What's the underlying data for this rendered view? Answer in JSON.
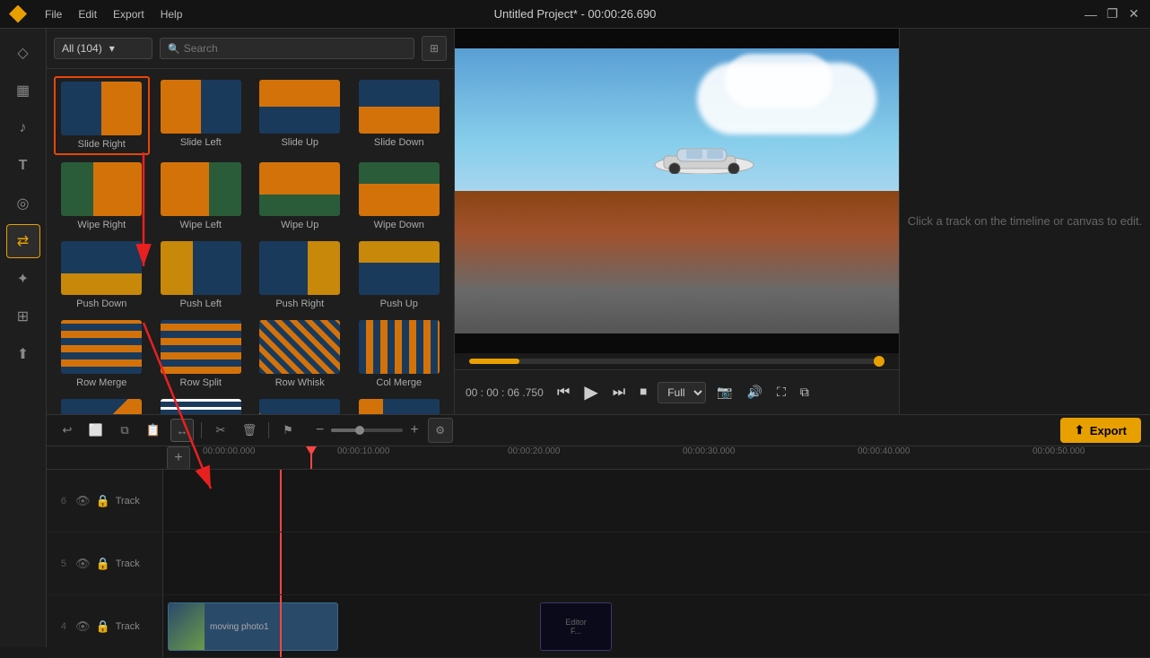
{
  "titlebar": {
    "title": "Untitled Project* - 00:00:26.690",
    "menu": [
      "File",
      "Edit",
      "Export",
      "Help"
    ],
    "controls": [
      "—",
      "❐",
      "✕"
    ]
  },
  "sidebar": {
    "items": [
      {
        "id": "logo",
        "icon": "◇",
        "label": "logo"
      },
      {
        "id": "media",
        "icon": "▦",
        "label": "media"
      },
      {
        "id": "audio",
        "icon": "🎵",
        "label": "audio"
      },
      {
        "id": "text",
        "icon": "T",
        "label": "text"
      },
      {
        "id": "effects",
        "icon": "◎",
        "label": "effects"
      },
      {
        "id": "transitions",
        "icon": "⇄",
        "label": "transitions",
        "active": true
      },
      {
        "id": "elements",
        "icon": "✦",
        "label": "elements"
      },
      {
        "id": "templates",
        "icon": "⊞",
        "label": "templates"
      },
      {
        "id": "export",
        "icon": "⬆",
        "label": "export"
      }
    ]
  },
  "panel": {
    "dropdown": {
      "label": "All (104)",
      "value": "All (104)"
    },
    "search": {
      "placeholder": "Search"
    },
    "transitions": [
      {
        "id": "slide-right",
        "label": "Slide Right",
        "thumb": "slide-right",
        "selected": true
      },
      {
        "id": "slide-left",
        "label": "Slide Left",
        "thumb": "slide-left"
      },
      {
        "id": "slide-up",
        "label": "Slide Up",
        "thumb": "slide-up"
      },
      {
        "id": "slide-down",
        "label": "Slide Down",
        "thumb": "slide-down"
      },
      {
        "id": "wipe-right",
        "label": "Wipe Right",
        "thumb": "wipe-right"
      },
      {
        "id": "wipe-left",
        "label": "Wipe Left",
        "thumb": "wipe-left"
      },
      {
        "id": "wipe-up",
        "label": "Wipe Up",
        "thumb": "wipe-up"
      },
      {
        "id": "wipe-down",
        "label": "Wipe Down",
        "thumb": "wipe-down"
      },
      {
        "id": "push-down",
        "label": "Push Down",
        "thumb": "push-down"
      },
      {
        "id": "push-left",
        "label": "Push Left",
        "thumb": "push-left"
      },
      {
        "id": "push-right",
        "label": "Push Right",
        "thumb": "push-right"
      },
      {
        "id": "push-up",
        "label": "Push Up",
        "thumb": "push-up"
      },
      {
        "id": "row-merge",
        "label": "Row Merge",
        "thumb": "row-merge"
      },
      {
        "id": "row-split",
        "label": "Row Split",
        "thumb": "row-split"
      },
      {
        "id": "row-whisk",
        "label": "Row Whisk",
        "thumb": "row-whisk"
      },
      {
        "id": "col-merge",
        "label": "Col Merge",
        "thumb": "col-merge"
      },
      {
        "id": "more1",
        "label": "...",
        "thumb": "more1"
      },
      {
        "id": "more2",
        "label": "...",
        "thumb": "more2"
      },
      {
        "id": "more3",
        "label": "...",
        "thumb": "more3"
      },
      {
        "id": "more4",
        "label": "...",
        "thumb": "more4"
      }
    ]
  },
  "preview": {
    "hint": "Click a track on the timeline or\ncanvas to edit.",
    "time": "00 : 00 : 06 .750",
    "quality": "Full",
    "progress_pct": 12
  },
  "timeline": {
    "current_time": "00:00:00.000",
    "ticks": [
      "00:00:00.000",
      "00:00:10.000",
      "00:00:20.000",
      "00:00:30.000",
      "00:00:40.000",
      "00:00:50.000"
    ],
    "tracks": [
      {
        "number": "6",
        "name": "Track",
        "clips": []
      },
      {
        "number": "5",
        "name": "Track",
        "clips": []
      },
      {
        "number": "4",
        "name": "Track",
        "clips": [
          "video",
          "editor"
        ]
      }
    ],
    "playhead_pos": "135px"
  },
  "toolbar": {
    "export_label": "Export",
    "add_track_label": "+"
  }
}
